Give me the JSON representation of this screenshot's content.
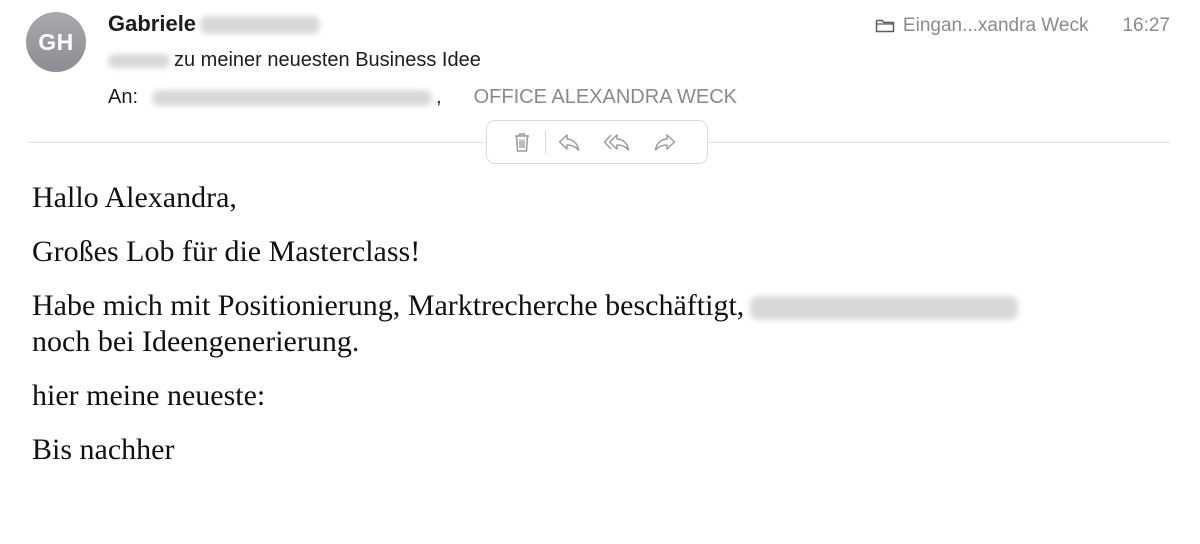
{
  "header": {
    "avatar_initials": "GH",
    "sender_name": "Gabriele",
    "mailbox": "Eingan...xandra Weck",
    "time": "16:27",
    "subject": "zu meiner neuesten Business Idee",
    "recipients_label": "An:",
    "recipient_separator": ",",
    "recipient_office": "OFFICE ALEXANDRA WECK"
  },
  "toolbar": {
    "icons": [
      "trash-icon",
      "reply-icon",
      "reply-all-icon",
      "forward-icon"
    ]
  },
  "body": {
    "greeting": "Hallo Alexandra,",
    "line_1": "Großes Lob für die Masterclass!",
    "line_2_start": "Habe mich mit Positionierung, Marktrecherche beschäftigt,",
    "line_2_end": "noch bei Ideengenerierung.",
    "line_3": "hier meine neueste:",
    "closing": "Bis nachher"
  },
  "colors": {
    "secondary_text": "#8a8a8e",
    "avatar_bg": "#9a9aa0",
    "divider": "#e3e3e6"
  }
}
